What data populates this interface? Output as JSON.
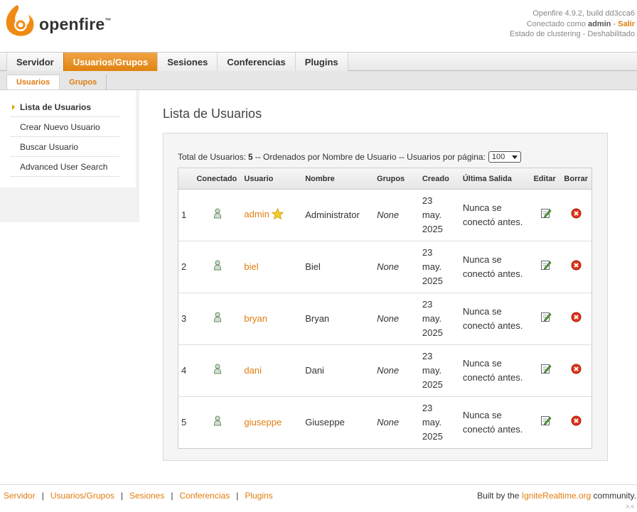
{
  "header": {
    "logo_text": "openfire",
    "version": "Openfire 4.9.2, build dd3cca6",
    "connected_prefix": "Conectado como",
    "user": "admin",
    "logout": "Salir",
    "clustering": "Estado de clustering - Deshabilitado"
  },
  "main_tabs": [
    "Servidor",
    "Usuarios/Grupos",
    "Sesiones",
    "Conferencias",
    "Plugins"
  ],
  "sub_tabs": [
    "Usuarios",
    "Grupos"
  ],
  "sidebar": {
    "items": [
      "Lista de Usuarios",
      "Crear Nuevo Usuario",
      "Buscar Usuario",
      "Advanced User Search"
    ]
  },
  "page": {
    "title": "Lista de Usuarios",
    "summary_prefix": "Total de Usuarios:",
    "total": "5",
    "summary_suffix": "-- Ordenados por Nombre de Usuario -- Usuarios por página:",
    "per_page": "100"
  },
  "table": {
    "headers": [
      "",
      "Conectado",
      "Usuario",
      "Nombre",
      "Grupos",
      "Creado",
      "Última Salida",
      "Editar",
      "Borrar"
    ],
    "rows": [
      {
        "num": "1",
        "username": "admin",
        "name": "Administrator",
        "groups": "None",
        "created": [
          "23",
          "may.",
          "2025"
        ],
        "last": [
          "Nunca se",
          "conectó antes."
        ]
      },
      {
        "num": "2",
        "username": "biel",
        "name": "Biel",
        "groups": "None",
        "created": [
          "23",
          "may.",
          "2025"
        ],
        "last": [
          "Nunca se",
          "conectó antes."
        ]
      },
      {
        "num": "3",
        "username": "bryan",
        "name": "Bryan",
        "groups": "None",
        "created": [
          "23",
          "may.",
          "2025"
        ],
        "last": [
          "Nunca se",
          "conectó antes."
        ]
      },
      {
        "num": "4",
        "username": "dani",
        "name": "Dani",
        "groups": "None",
        "created": [
          "23",
          "may.",
          "2025"
        ],
        "last": [
          "Nunca se",
          "conectó antes."
        ]
      },
      {
        "num": "5",
        "username": "giuseppe",
        "name": "Giuseppe",
        "groups": "None",
        "created": [
          "23",
          "may.",
          "2025"
        ],
        "last": [
          "Nunca se",
          "conectó antes."
        ]
      }
    ]
  },
  "footer": {
    "links": [
      "Servidor",
      "Usuarios/Grupos",
      "Sesiones",
      "Conferencias",
      "Plugins"
    ],
    "credit_prefix": "Built by the",
    "credit_link": "IgniteRealtime.org",
    "credit_suffix": "community."
  },
  "colors": {
    "accent": "#e07d10",
    "tab_active": "#e5890f"
  }
}
